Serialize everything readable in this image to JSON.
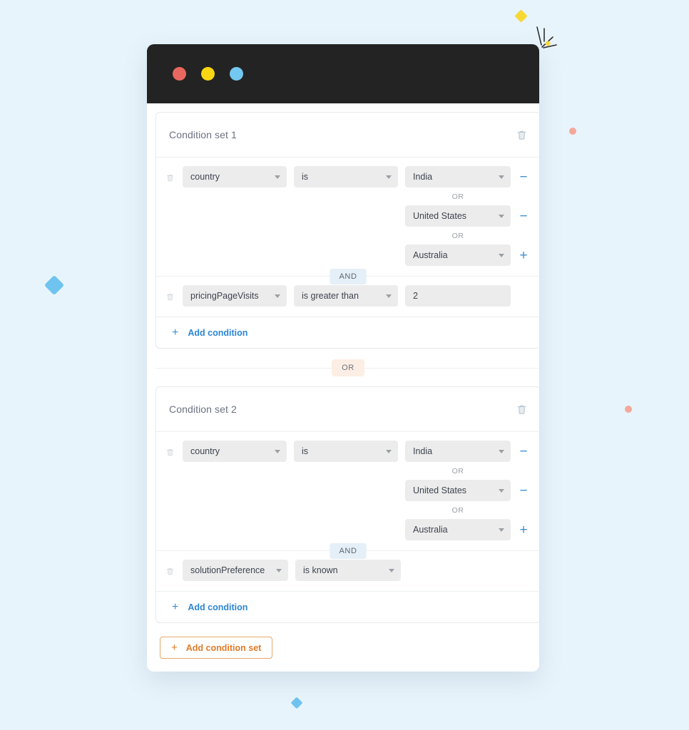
{
  "window": {
    "titlebar": {
      "dots": [
        {
          "name": "close-dot",
          "color": "#e8685f"
        },
        {
          "name": "minimize-dot",
          "color": "#fbd612"
        },
        {
          "name": "maximize-dot",
          "color": "#73c7f0"
        }
      ]
    }
  },
  "builder": {
    "set_separator_label": "OR",
    "add_condition_set_label": "Add condition set",
    "add_condition_set_icon": "plus-icon",
    "condition_sets": [
      {
        "title": "Condition set 1",
        "delete_icon": "trash-icon",
        "add_condition_label": "Add condition",
        "add_condition_icon": "plus-icon",
        "group_joiner": "AND",
        "groups": [
          {
            "row_delete_icon": "trash-icon",
            "field": "country",
            "operator": "is",
            "value_joiner": "OR",
            "values": [
              {
                "text": "India",
                "control": "minus-icon",
                "type": "select"
              },
              {
                "text": "United States",
                "control": "minus-icon",
                "type": "select"
              },
              {
                "text": "Australia",
                "control": "plus-icon",
                "type": "select"
              }
            ]
          },
          {
            "row_delete_icon": "trash-icon",
            "field": "pricingPageVisits",
            "operator": "is greater than",
            "value_joiner": "OR",
            "values": [
              {
                "text": "2",
                "control": "none",
                "type": "text"
              }
            ]
          }
        ]
      },
      {
        "title": "Condition set 2",
        "delete_icon": "trash-icon",
        "add_condition_label": "Add condition",
        "add_condition_icon": "plus-icon",
        "group_joiner": "AND",
        "groups": [
          {
            "row_delete_icon": "trash-icon",
            "field": "country",
            "operator": "is",
            "value_joiner": "OR",
            "values": [
              {
                "text": "India",
                "control": "minus-icon",
                "type": "select"
              },
              {
                "text": "United States",
                "control": "minus-icon",
                "type": "select"
              },
              {
                "text": "Australia",
                "control": "plus-icon",
                "type": "select"
              }
            ]
          },
          {
            "row_delete_icon": "trash-icon",
            "field": "solutionPreference",
            "operator": "is known",
            "value_joiner": "OR",
            "values": []
          }
        ]
      }
    ]
  },
  "decorations": [
    {
      "name": "yellow-diamond",
      "color": "#f7d935"
    },
    {
      "name": "blue-diamond-large",
      "color": "#6ec4ef"
    },
    {
      "name": "blue-diamond-small",
      "color": "#6ec4ef"
    },
    {
      "name": "pink-dot-upper",
      "color": "#f4a79a"
    },
    {
      "name": "pink-dot-lower",
      "color": "#f4a79a"
    },
    {
      "name": "sparkle-burst",
      "color": "#2f2f2f"
    }
  ],
  "theme": {
    "page_background": "#e8f4fb",
    "titlebar_background": "#232323",
    "accent_blue": "#2d86d2",
    "accent_orange": "#e07b2a",
    "and_badge_background": "#e5eff7",
    "or_badge_background": "#fceee4",
    "select_background": "#ececec"
  }
}
